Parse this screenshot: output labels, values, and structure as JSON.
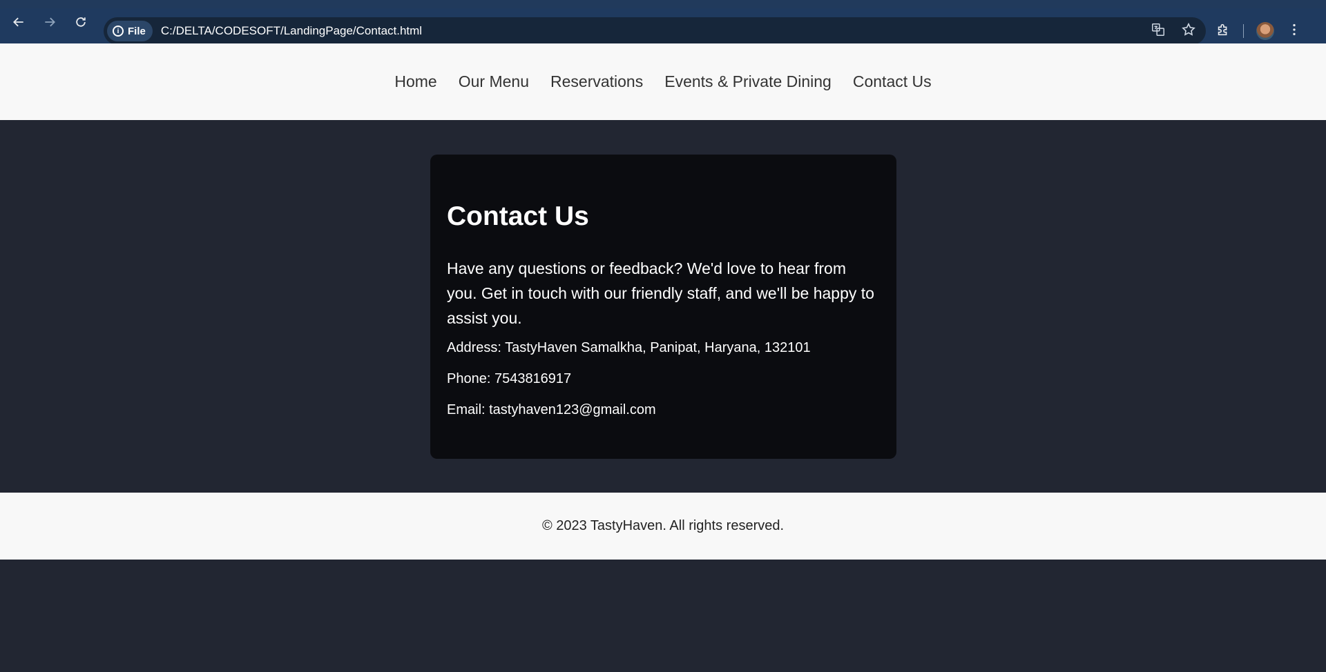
{
  "browser": {
    "file_chip": "File",
    "url": "C:/DELTA/CODESOFT/LandingPage/Contact.html",
    "icons": [
      "back-icon",
      "forward-icon",
      "reload-icon",
      "info-icon",
      "translate-icon",
      "star-icon",
      "extensions-icon",
      "profile-avatar",
      "menu-icon"
    ]
  },
  "nav": {
    "items": [
      "Home",
      "Our Menu",
      "Reservations",
      "Events & Private Dining",
      "Contact Us"
    ]
  },
  "contact": {
    "title": "Contact Us",
    "lead": "Have any questions or feedback? We'd love to hear from you. Get in touch with our friendly staff, and we'll be happy to assist you.",
    "address": "Address: TastyHaven Samalkha, Panipat, Haryana, 132101",
    "phone": "Phone: 7543816917",
    "email": "Email: tastyhaven123@gmail.com"
  },
  "footer": {
    "text": "© 2023 TastyHaven. All rights reserved."
  },
  "colors": {
    "browser_bar": "#1f3a5f",
    "page_bg": "#222632",
    "card_bg": "#0b0c10",
    "header_bg": "#f8f8f8"
  }
}
